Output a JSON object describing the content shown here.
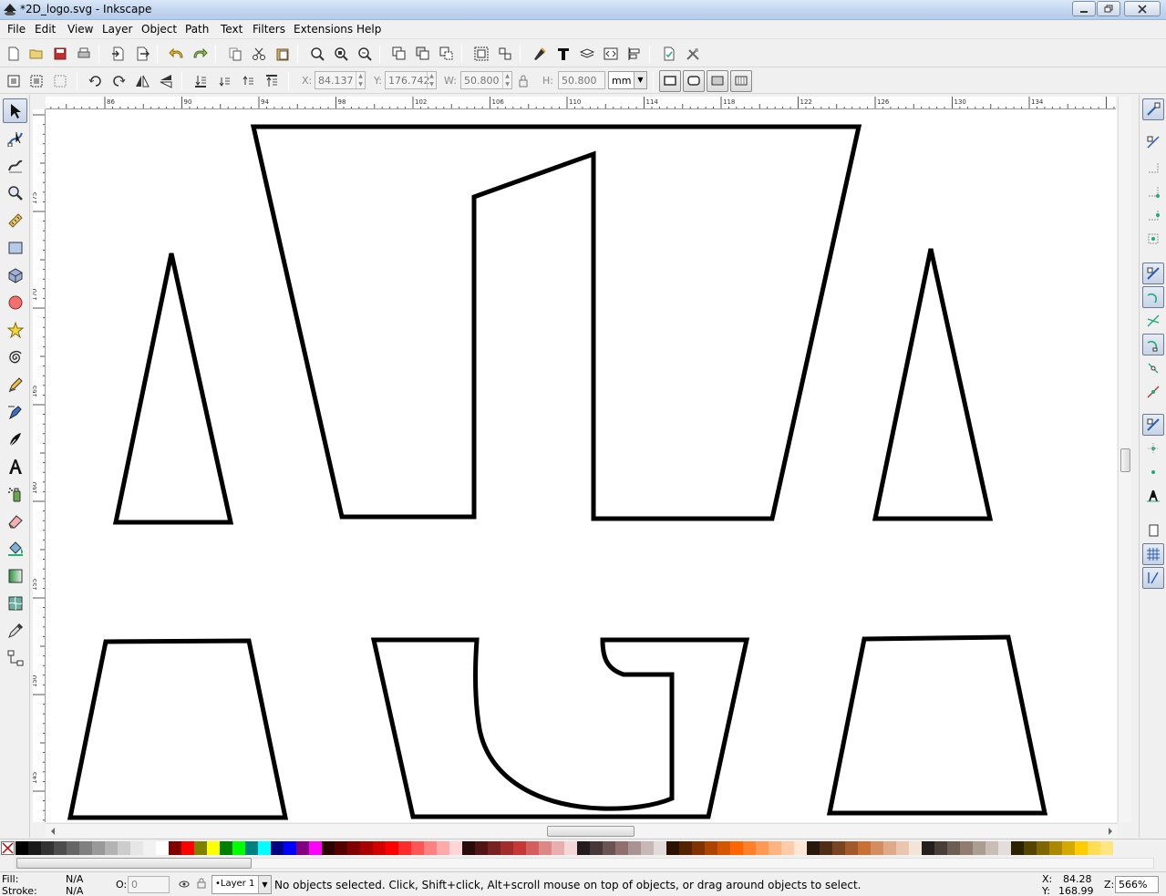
{
  "window": {
    "title": "*2D_logo.svg - Inkscape",
    "minimize": "0",
    "maximize": "1",
    "close": "r"
  },
  "menu": [
    "File",
    "Edit",
    "View",
    "Layer",
    "Object",
    "Path",
    "Text",
    "Filters",
    "Extensions",
    "Help"
  ],
  "controls": {
    "x_label": "X:",
    "x_value": "84.137",
    "y_label": "Y:",
    "y_value": "176.742",
    "w_label": "W:",
    "w_value": "50.800",
    "h_label": "H:",
    "h_value": "50.800",
    "unit": "mm"
  },
  "rulers": {
    "top_ticks": [
      "86",
      "90",
      "94",
      "98",
      "102",
      "106",
      "110",
      "114",
      "118",
      "122",
      "126",
      "130",
      "134"
    ],
    "left_ticks": [
      "175",
      "170",
      "165",
      "160",
      "155",
      "150",
      "145",
      "140"
    ]
  },
  "status": {
    "fill_label": "Fill:",
    "fill_value": "N/A",
    "stroke_label": "Stroke:",
    "stroke_value": "N/A",
    "opacity_label": "O:",
    "opacity_value": "0",
    "layer": "•Layer 1",
    "message": "No objects selected. Click, Shift+click, Alt+scroll mouse on top of objects, or drag around objects to select.",
    "x_label": "X:",
    "x_value": "84.28",
    "y_label": "Y:",
    "y_value": "168.99",
    "zoom_label": "Z:",
    "zoom_value": "566%"
  },
  "palette": [
    "#000000",
    "#1a1a1a",
    "#333333",
    "#4d4d4d",
    "#666666",
    "#808080",
    "#999999",
    "#b3b3b3",
    "#cccccc",
    "#e6e6e6",
    "#f2f2f2",
    "#ffffff",
    "#800000",
    "#ff0000",
    "#808000",
    "#ffff00",
    "#008000",
    "#00ff00",
    "#008080",
    "#00ffff",
    "#000080",
    "#0000ff",
    "#800080",
    "#ff00ff",
    "#2b0000",
    "#550000",
    "#800000",
    "#aa0000",
    "#d40000",
    "#ff0000",
    "#ff2a2a",
    "#ff5555",
    "#ff8080",
    "#ffaaaa",
    "#ffd5d5",
    "#280b0b",
    "#501616",
    "#782121",
    "#a02c2c",
    "#c83737",
    "#d35f5f",
    "#de8787",
    "#e9afaf",
    "#f4d7d7",
    "#241c1c",
    "#483737",
    "#6c5353",
    "#916f6f",
    "#ac9393",
    "#c8b7b7",
    "#e3dbdb",
    "#2b1100",
    "#552200",
    "#803300",
    "#aa4400",
    "#d45500",
    "#ff6600",
    "#ff7f2a",
    "#ff9955",
    "#ffb380",
    "#ffccaa",
    "#ffe6d5",
    "#28170b",
    "#502d16",
    "#784421",
    "#a05a2c",
    "#c87137",
    "#d38d5f",
    "#deaa87",
    "#e9c6af",
    "#f4e3d7",
    "#241f1c",
    "#483e37",
    "#6c5d53",
    "#917c6f",
    "#ac9d93",
    "#c8beb7",
    "#e3dedb",
    "#2b2200",
    "#554400",
    "#806600",
    "#aa8800",
    "#d4aa00",
    "#ffcc00",
    "#ffdd55",
    "#ffe680"
  ]
}
